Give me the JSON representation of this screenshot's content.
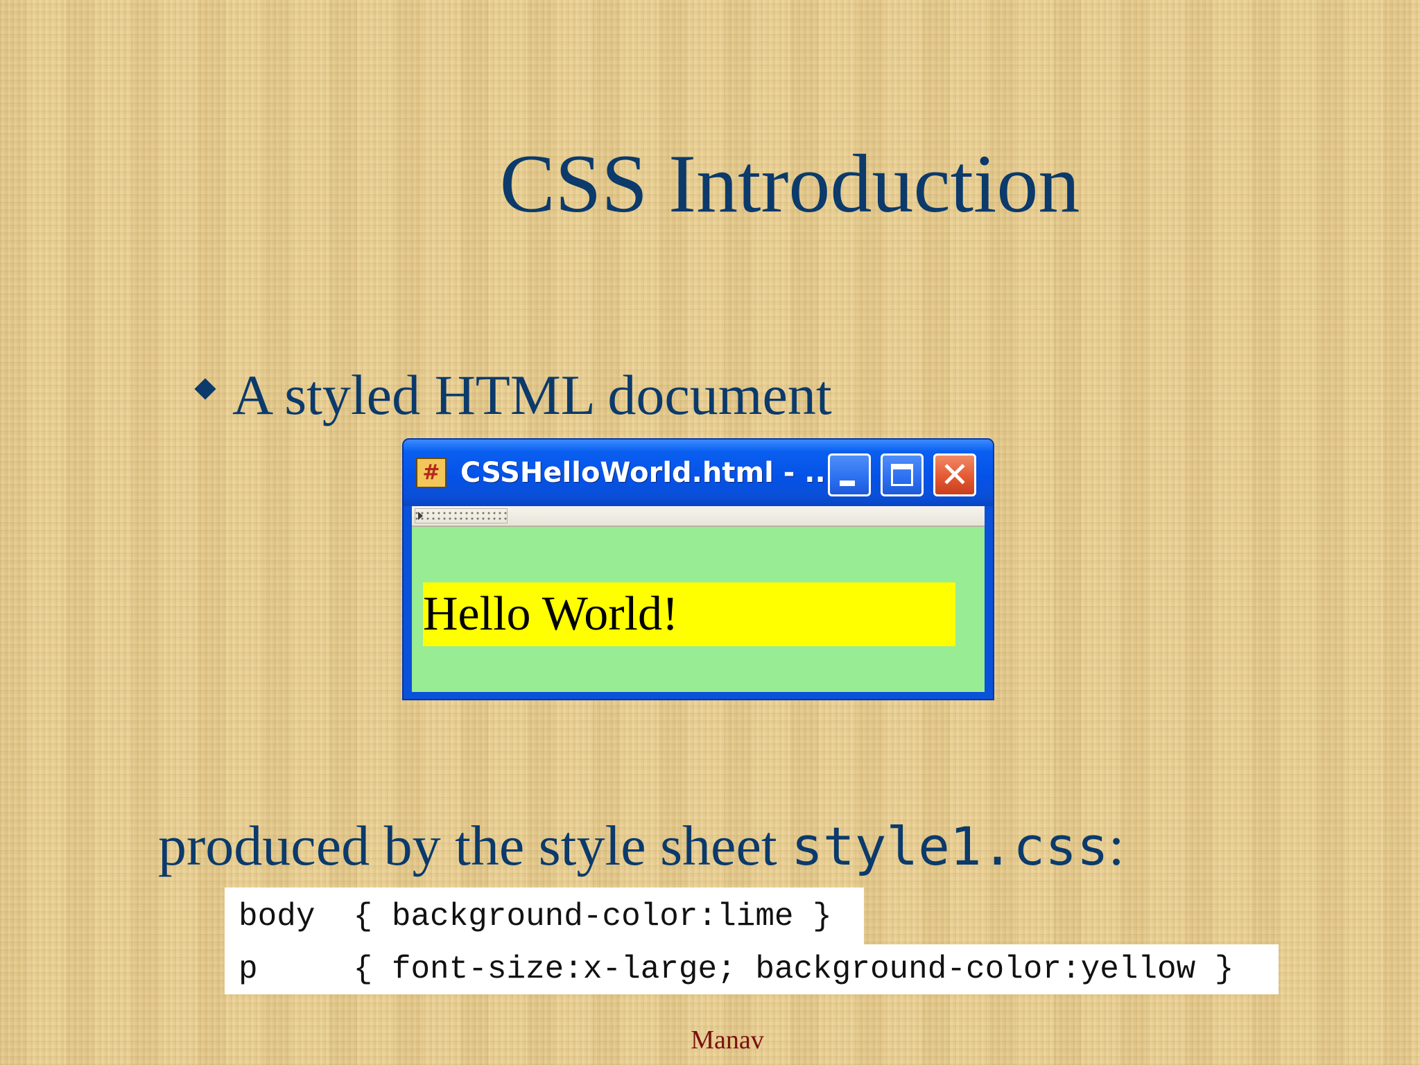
{
  "slide": {
    "title": "CSS Introduction",
    "bullet": "A styled HTML document",
    "produced_prefix": "produced by the style sheet ",
    "produced_code": "style1.css",
    "produced_suffix": ":",
    "footer": "Manav"
  },
  "browser_window": {
    "title": "CSSHelloWorld.html - ...",
    "paragraph": "Hello World!",
    "icons": {
      "app": "app-icon",
      "minimize": "minimize-icon",
      "maximize": "maximize-icon",
      "close": "close-icon"
    },
    "colors": {
      "body_background": "#98ec94",
      "paragraph_background": "#ffff00",
      "titlebar": "#0552e8"
    }
  },
  "css_code": {
    "line1": "body  { background-color:lime }",
    "line2": "p     { font-size:x-large; background-color:yellow }"
  },
  "colors": {
    "title_text": "#0b3a6b",
    "footer_text": "#7a0f0f"
  }
}
